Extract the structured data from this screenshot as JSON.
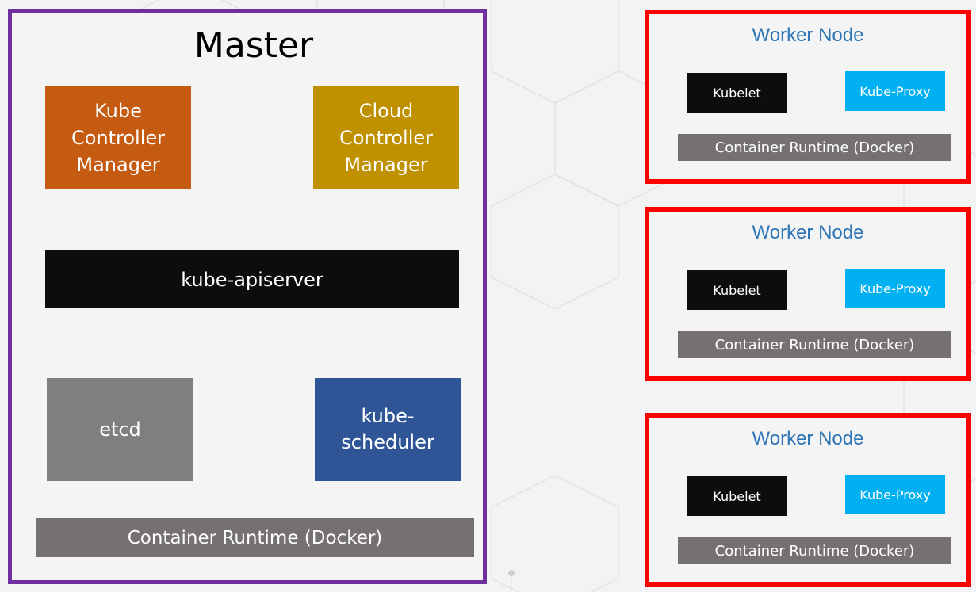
{
  "master": {
    "title": "Master",
    "kube_controller_manager": [
      "Kube",
      "Controller",
      "Manager"
    ],
    "cloud_controller_manager": [
      "Cloud",
      "Controller",
      "Manager"
    ],
    "apiserver": "kube-apiserver",
    "etcd": "etcd",
    "scheduler": [
      "kube-",
      "scheduler"
    ],
    "runtime": "Container Runtime (Docker)"
  },
  "workers": [
    {
      "title": "Worker Node",
      "kubelet": "Kubelet",
      "proxy": "Kube-Proxy",
      "runtime": "Container Runtime (Docker)"
    },
    {
      "title": "Worker Node",
      "kubelet": "Kubelet",
      "proxy": "Kube-Proxy",
      "runtime": "Container Runtime (Docker)"
    },
    {
      "title": "Worker Node",
      "kubelet": "Kubelet",
      "proxy": "Kube-Proxy",
      "runtime": "Container Runtime (Docker)"
    }
  ],
  "colors": {
    "master_border": "#7030a0",
    "worker_border": "#ff0000",
    "kube_controller_manager": "#c55a11",
    "cloud_controller_manager": "#bf9000",
    "apiserver": "#0d0d0d",
    "etcd": "#7f7f7f",
    "scheduler": "#2f5597",
    "runtime": "#767171",
    "kubelet": "#0d0d0d",
    "proxy": "#00b0f0",
    "worker_title": "#2e75b6"
  }
}
